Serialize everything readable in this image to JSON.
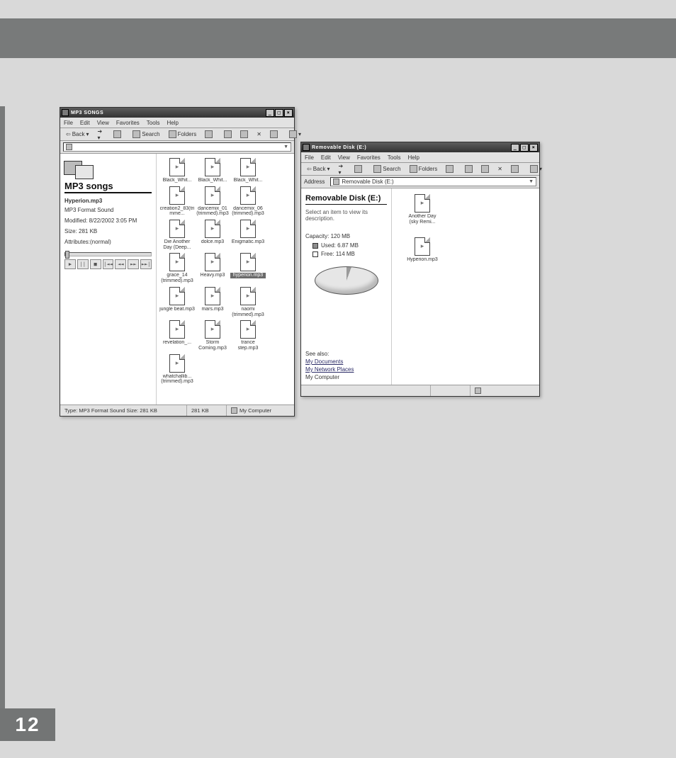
{
  "page_number": "12",
  "window1": {
    "title": "MP3 SONGS",
    "menus": [
      "File",
      "Edit",
      "View",
      "Favorites",
      "Tools",
      "Help"
    ],
    "toolbar": {
      "back": "Back",
      "search": "Search",
      "folders": "Folders"
    },
    "address_value": "",
    "left": {
      "heading": "MP3 songs",
      "filename": "Hyperion.mp3",
      "filetype": "MP3 Format Sound",
      "modified": "Modified: 8/22/2002 3:05 PM",
      "size": "Size: 281 KB",
      "attributes": "Attributes:(normal)"
    },
    "files": [
      {
        "label": "Black_Whit..."
      },
      {
        "label": "Black_Whit..."
      },
      {
        "label": "Black_Whit..."
      },
      {
        "label": "creation2_83(trimme..."
      },
      {
        "label": "dancemix_01 (trimmed).mp3"
      },
      {
        "label": "dancemix_06 (trimmed).mp3"
      },
      {
        "label": "Die Another Day (Deep..."
      },
      {
        "label": "dolce.mp3"
      },
      {
        "label": "Enigmatic.mp3"
      },
      {
        "label": "grace_14 (trimmed).mp3"
      },
      {
        "label": "Heavy.mp3"
      },
      {
        "label": "hyperion.mp3",
        "selected": true
      },
      {
        "label": "jungle beat.mp3"
      },
      {
        "label": "mars.mp3"
      },
      {
        "label": "naomi (trimmed).mp3"
      },
      {
        "label": "revelation_..."
      },
      {
        "label": "Storm Coming.mp3"
      },
      {
        "label": "trance step.mp3"
      },
      {
        "label": "whatchallib... (trimmed).mp3"
      }
    ],
    "status": {
      "left": "Type: MP3 Format Sound Size: 281 KB",
      "mid": "281 KB",
      "right": "My Computer"
    }
  },
  "window2": {
    "title": "Removable Disk (E:)",
    "menus": [
      "File",
      "Edit",
      "View",
      "Favorites",
      "Tools",
      "Help"
    ],
    "toolbar": {
      "back": "Back",
      "search": "Search",
      "folders": "Folders"
    },
    "address_label": "Address",
    "address_value": "Removable Disk (E:)",
    "left": {
      "heading": "Removable Disk (E:)",
      "select_hint": "Select an item to view its description.",
      "capacity": "Capacity: 120 MB",
      "used": "Used: 6.87 MB",
      "free": "Free: 114 MB",
      "seealso_label": "See also:",
      "links": [
        "My Documents",
        "My Network Places",
        "My Computer"
      ]
    },
    "files": [
      {
        "label": "Another Day (sky Remi..."
      },
      {
        "label": "Hyperion.mp3"
      }
    ]
  }
}
